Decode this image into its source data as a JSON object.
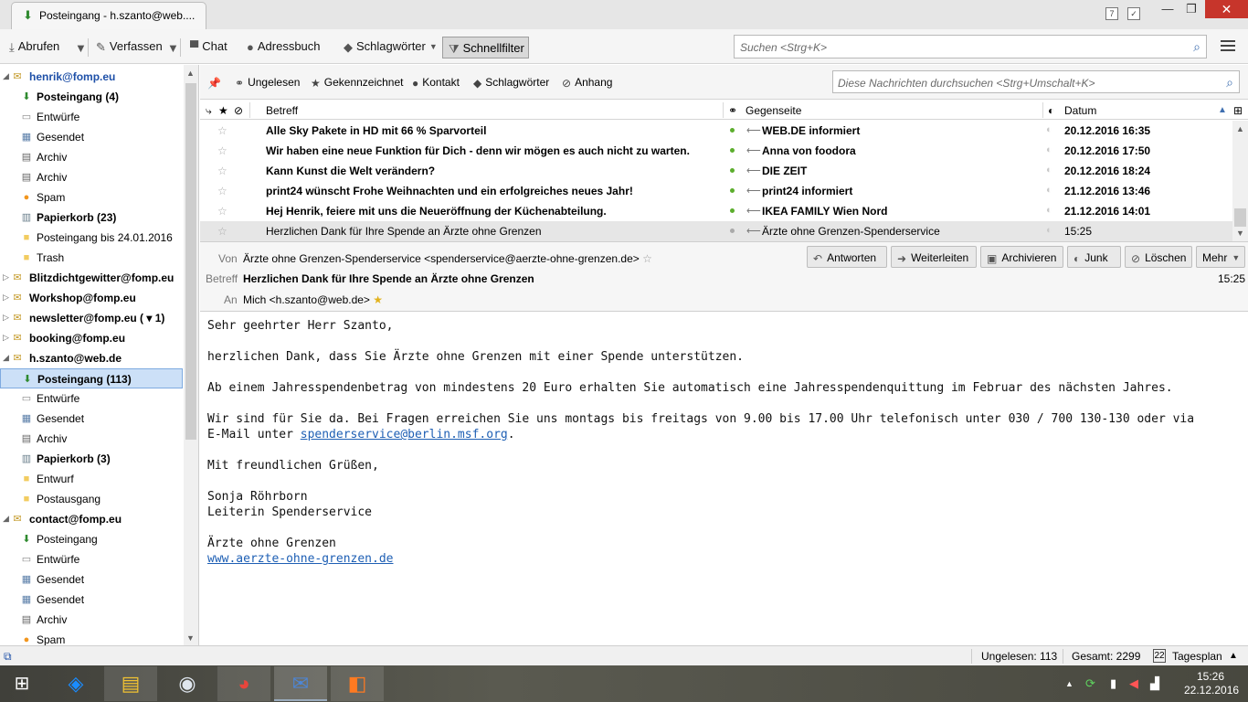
{
  "titlebar": {
    "tab_title": "Posteingang - h.szanto@web....",
    "window_buttons": [
      "minimize-icon",
      "restore-icon",
      "close-icon"
    ]
  },
  "toolbar": {
    "abrufen": "Abrufen",
    "verfassen": "Verfassen",
    "chat": "Chat",
    "adressbuch": "Adressbuch",
    "schlagwoerter": "Schlagwörter",
    "schnellfilter": "Schnellfilter",
    "search_placeholder": "Suchen <Strg+K>"
  },
  "folders": [
    {
      "label": "henrik@fomp.eu",
      "type": "account",
      "bold": true,
      "accent": "#1e50a8"
    },
    {
      "label": "Posteingang (4)",
      "type": "inbox",
      "bold": true
    },
    {
      "label": "Entwürfe",
      "type": "drafts"
    },
    {
      "label": "Gesendet",
      "type": "sent"
    },
    {
      "label": "Archiv",
      "type": "archive"
    },
    {
      "label": "Archiv",
      "type": "archive"
    },
    {
      "label": "Spam",
      "type": "spam"
    },
    {
      "label": "Papierkorb (23)",
      "type": "trash",
      "bold": true
    },
    {
      "label": "Posteingang bis 24.01.2016",
      "type": "folder"
    },
    {
      "label": "Trash",
      "type": "folder"
    },
    {
      "label": "Blitzdichtgewitter@fomp.eu",
      "type": "account",
      "bold": true
    },
    {
      "label": "Workshop@fomp.eu",
      "type": "account",
      "bold": true
    },
    {
      "label": "newsletter@fomp.eu ( ▾ 1)",
      "type": "account",
      "bold": true
    },
    {
      "label": "booking@fomp.eu",
      "type": "account",
      "bold": true
    },
    {
      "label": "h.szanto@web.de",
      "type": "account",
      "bold": true
    },
    {
      "label": "Posteingang (113)",
      "type": "inbox",
      "bold": true,
      "selected": true
    },
    {
      "label": "Entwürfe",
      "type": "drafts"
    },
    {
      "label": "Gesendet",
      "type": "sent"
    },
    {
      "label": "Archiv",
      "type": "archive"
    },
    {
      "label": "Papierkorb (3)",
      "type": "trash",
      "bold": true
    },
    {
      "label": "Entwurf",
      "type": "folder"
    },
    {
      "label": "Postausgang",
      "type": "folder"
    },
    {
      "label": "contact@fomp.eu",
      "type": "account",
      "bold": true
    },
    {
      "label": "Posteingang",
      "type": "inbox"
    },
    {
      "label": "Entwürfe",
      "type": "drafts"
    },
    {
      "label": "Gesendet",
      "type": "sent"
    },
    {
      "label": "Gesendet",
      "type": "sent"
    },
    {
      "label": "Archiv",
      "type": "archive"
    },
    {
      "label": "Spam",
      "type": "spam"
    }
  ],
  "quickfilter": {
    "ungelesen": "Ungelesen",
    "gekennzeichnet": "Gekennzeichnet",
    "kontakt": "Kontakt",
    "schlagwoerter": "Schlagwörter",
    "anhang": "Anhang",
    "search_placeholder": "Diese Nachrichten durchsuchen <Strg+Umschalt+K>"
  },
  "columns": {
    "betreff": "Betreff",
    "gegenseite": "Gegenseite",
    "datum": "Datum"
  },
  "messages": [
    {
      "subject": "Alle Sky Pakete in HD mit 66 % Sparvorteil",
      "sender": "WEB.DE informiert",
      "date": "20.12.2016 16:35",
      "unread": true
    },
    {
      "subject": "Wir haben eine neue Funktion für Dich - denn wir mögen es auch nicht zu warten.",
      "sender": "Anna von foodora",
      "date": "20.12.2016 17:50",
      "unread": true
    },
    {
      "subject": "Kann Kunst die Welt verändern?",
      "sender": "DIE ZEIT",
      "date": "20.12.2016 18:24",
      "unread": true
    },
    {
      "subject": "print24 wünscht Frohe Weihnachten und ein erfolgreiches neues Jahr!",
      "sender": "print24 informiert",
      "date": "21.12.2016 13:46",
      "unread": true
    },
    {
      "subject": "Hej Henrik, feiere mit uns die Neueröffnung der Küchenabteilung.",
      "sender": "IKEA FAMILY Wien Nord",
      "date": "21.12.2016 14:01",
      "unread": true
    },
    {
      "subject": "Herzlichen Dank für Ihre Spende an Ärzte ohne Grenzen",
      "sender": "Ärzte ohne Grenzen-Spenderservice",
      "date": "15:25",
      "unread": false,
      "selected": true
    }
  ],
  "header": {
    "von_label": "Von",
    "von_value": "Ärzte ohne Grenzen-Spenderservice <spenderservice@aerzte-ohne-grenzen.de>",
    "betreff_label": "Betreff",
    "betreff_value": "Herzlichen Dank für Ihre Spende an Ärzte ohne Grenzen",
    "an_label": "An",
    "an_value": "Mich <h.szanto@web.de>",
    "time": "15:25",
    "actions": {
      "antworten": "Antworten",
      "weiterleiten": "Weiterleiten",
      "archivieren": "Archivieren",
      "junk": "Junk",
      "loeschen": "Löschen",
      "mehr": "Mehr"
    }
  },
  "body": {
    "greeting": "Sehr geehrter Herr Szanto,",
    "p1": "herzlichen Dank, dass Sie Ärzte ohne Grenzen mit einer Spende unterstützen.",
    "p2": "Ab einem Jahresspendenbetrag von mindestens 20 Euro erhalten Sie automatisch eine Jahresspendenquittung im Februar des nächsten Jahres.",
    "p3_line1": "Wir sind für Sie da. Bei Fragen erreichen Sie uns montags bis freitags von 9.00 bis 17.00 Uhr telefonisch unter 030 / 700 130-130 oder via",
    "p3_line2_prefix": "E-Mail unter ",
    "p3_email": "spenderservice@berlin.msf.org",
    "p3_suffix": ".",
    "closing": "Mit freundlichen Grüßen,",
    "sig_name": "Sonja Röhrborn",
    "sig_title": "Leiterin Spenderservice",
    "org": "Ärzte ohne Grenzen",
    "website": "www.aerzte-ohne-grenzen.de"
  },
  "statusbar": {
    "ungelesen": "Ungelesen: 113",
    "gesamt": "Gesamt: 2299",
    "tagesplan": "Tagesplan",
    "tagesplan_day": "22"
  },
  "taskbar": {
    "apps": [
      "windows-start-icon",
      "dropbox-icon",
      "file-explorer-icon",
      "steam-icon",
      "chrome-icon",
      "thunderbird-icon",
      "foxit-pdf-icon"
    ],
    "time": "15:26",
    "date": "22.12.2016"
  }
}
